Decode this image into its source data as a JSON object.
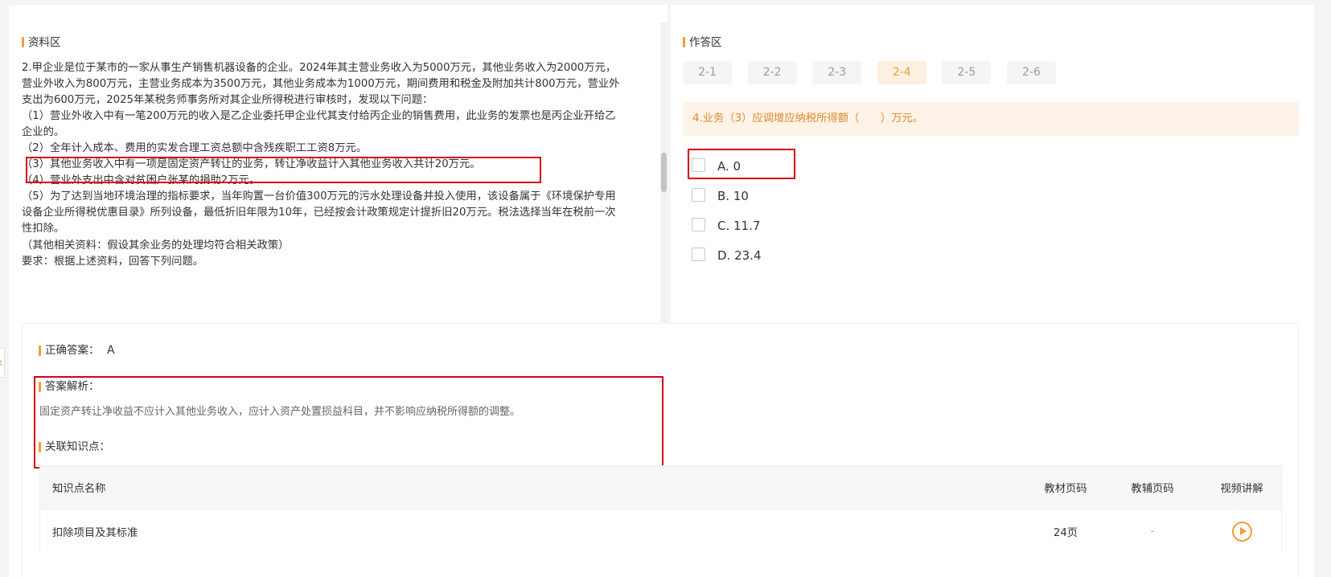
{
  "material": {
    "title": "资料区",
    "lines": [
      "2.甲企业是位于某市的一家从事生产销售机器设备的企业。2024年其主营业务收入为5000万元，其他业务收入为2000万元，",
      "营业外收入为800万元，主营业务成本为3500万元，其他业务成本为1000万元，期间费用和税金及附加共计800万元，营业外",
      "支出为600万元，2025年某税务师事务所对其企业所得税进行审核时，发现以下问题：",
      "（1）营业外收入中有一笔200万元的收入是乙企业委托甲企业代其支付给丙企业的销售费用，此业务的发票也是丙企业开给乙",
      "企业的。",
      "（2）全年计入成本、费用的实发合理工资总额中含残疾职工工资8万元。",
      "（3）其他业务收入中有一项是固定资产转让的业务，转让净收益计入其他业务收入共计20万元。",
      "（4）营业外支出中含对贫困户张某的捐助2万元。",
      "（5）为了达到当地环境治理的指标要求，当年购置一台价值300万元的污水处理设备并投入使用，该设备属于《环境保护专用",
      "设备企业所得税优惠目录》所列设备，最低折旧年限为10年，已经按会计政策规定计提折旧20万元。税法选择当年在税前一次",
      "性扣除。",
      "（其他相关资料：假设其余业务的处理均符合相关政策）",
      "要求：根据上述资料，回答下列问题。"
    ]
  },
  "answer_area": {
    "title": "作答区",
    "tabs": [
      {
        "label": "2-1",
        "active": false
      },
      {
        "label": "2-2",
        "active": false
      },
      {
        "label": "2-3",
        "active": false
      },
      {
        "label": "2-4",
        "active": true
      },
      {
        "label": "2-5",
        "active": false
      },
      {
        "label": "2-6",
        "active": false
      }
    ],
    "question": "4.业务（3）应调增应纳税所得额（　　）万元。",
    "options": [
      {
        "label": "A. 0",
        "checked": false
      },
      {
        "label": "B. 10",
        "checked": false
      },
      {
        "label": "C. 11.7",
        "checked": false
      },
      {
        "label": "D. 23.4",
        "checked": false
      }
    ]
  },
  "result": {
    "collapse_icon": "chevron-left-icon",
    "correct_label": "正确答案：",
    "correct_value": "A",
    "analysis_label": "答案解析：",
    "analysis_text": "固定资产转让净收益不应计入其他业务收入，应计入资产处置损益科目，并不影响应纳税所得额的调整。",
    "knowledge_label": "关联知识点：",
    "table": {
      "headers": [
        "知识点名称",
        "教材页码",
        "教辅页码",
        "视频讲解"
      ],
      "rows": [
        {
          "name": "扣除项目及其标准",
          "textbook_page": "24页",
          "aux_page": "-",
          "video_icon": "play-icon"
        }
      ]
    }
  },
  "colors": {
    "accent": "#f39c3a",
    "highlight": "#d9000f",
    "question_bg": "#fdf3e8",
    "question_text": "#e08a2c"
  }
}
